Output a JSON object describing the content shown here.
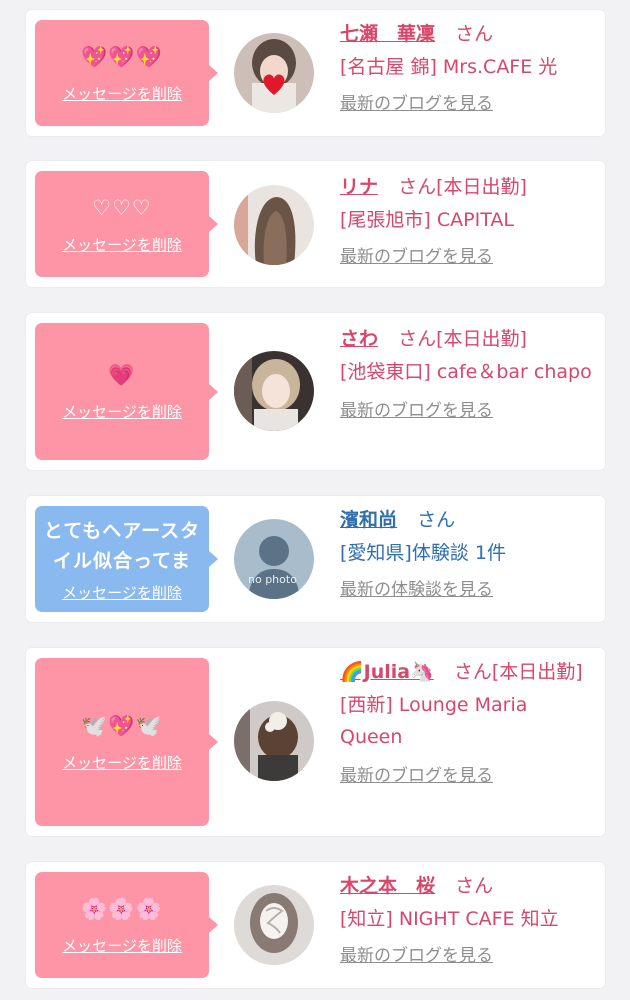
{
  "cards": [
    {
      "message": "💖💖💖",
      "delete_label": "メッセージを削除",
      "name": "七瀬　華凜",
      "san": "さん",
      "shop": "[名古屋 錦] Mrs.CAFE 光",
      "link": "最新のブログを見る"
    },
    {
      "message": "♡♡♡",
      "delete_label": "メッセージを削除",
      "name": "リナ",
      "san": "さん[本日出勤]",
      "shop": "[尾張旭市] CAPITAL",
      "link": "最新のブログを見る"
    },
    {
      "message": "💗",
      "delete_label": "メッセージを削除",
      "name": "さわ",
      "san": "さん[本日出勤]",
      "shop": "[池袋東口] cafe＆bar chapo",
      "link": "最新のブログを見る"
    },
    {
      "message": "とてもヘアースタイル似合ってま",
      "delete_label": "メッセージを削除",
      "name": "濱和尚",
      "san": "さん",
      "shop": "[愛知県]体験談 1件",
      "link": "最新の体験談を見る",
      "avatar_text": "no photo"
    },
    {
      "message": "🕊️💖🕊️",
      "delete_label": "メッセージを削除",
      "name": "🌈Julia🦄",
      "san": "さん[本日出勤]",
      "shop": "[西新] Lounge Maria Queen",
      "link": "最新のブログを見る"
    },
    {
      "message": "🌸🌸🌸",
      "delete_label": "メッセージを削除",
      "name": "木之本　桜",
      "san": "さん",
      "shop": "[知立] NIGHT CAFE 知立",
      "link": "最新のブログを見る"
    }
  ],
  "colors": {
    "pink_bubble": "#fd95a7",
    "blue_bubble": "#8ab9ef",
    "pink_text": "#d9466a",
    "blue_text": "#2f6fb0",
    "link_gray": "#8e8e8e"
  }
}
